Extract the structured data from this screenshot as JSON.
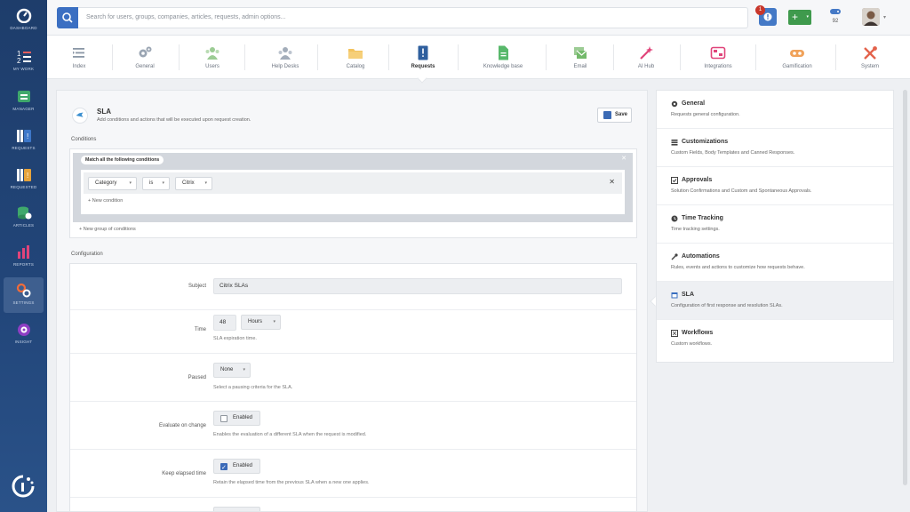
{
  "nav": {
    "items": [
      {
        "label": "DASHBOARD",
        "icon": "gauge-icon"
      },
      {
        "label": "MY WORK",
        "icon": "my-work-icon"
      },
      {
        "label": "MANAGER",
        "icon": "manager-icon"
      },
      {
        "label": "REQUESTS",
        "icon": "requests-icon"
      },
      {
        "label": "REQUESTED",
        "icon": "requested-icon"
      },
      {
        "label": "ARTICLES",
        "icon": "articles-icon"
      },
      {
        "label": "REPORTS",
        "icon": "reports-icon"
      },
      {
        "label": "SETTINGS",
        "icon": "settings-icon"
      },
      {
        "label": "INSIGHT",
        "icon": "insight-icon"
      }
    ]
  },
  "topbar": {
    "search_placeholder": "Search for users, groups, companies, articles, requests, admin options...",
    "notif_count": "1",
    "add_label": "+",
    "points": "92"
  },
  "tabs": [
    {
      "label": "Index"
    },
    {
      "label": "General"
    },
    {
      "label": "Users"
    },
    {
      "label": "Help Desks"
    },
    {
      "label": "Catalog"
    },
    {
      "label": "Requests"
    },
    {
      "label": "Knowledge base"
    },
    {
      "label": "Email"
    },
    {
      "label": "AI Hub"
    },
    {
      "label": "Integrations"
    },
    {
      "label": "Gamification"
    },
    {
      "label": "System"
    }
  ],
  "page": {
    "title": "SLA",
    "subtitle": "Add conditions and actions that will be executed upon request creation.",
    "save_label": "Save"
  },
  "conditions": {
    "title": "Conditions",
    "match_label": "Match all the following conditions",
    "field": "Category",
    "operator": "is",
    "value": "Citrix",
    "new_condition": "+ New condition",
    "new_group": "+ New group of conditions"
  },
  "configuration": {
    "title": "Configuration",
    "subject_label": "Subject",
    "subject_value": "Citrix SLAs",
    "time_label": "Time",
    "time_value": "48",
    "time_unit": "Hours",
    "time_help": "SLA expiration time.",
    "paused_label": "Paused",
    "paused_value": "None",
    "paused_help": "Select a pausing criteria for the SLA.",
    "evaluate_label": "Evaluate on change",
    "evaluate_value": "Enabled",
    "evaluate_checked": false,
    "evaluate_help": "Enables the evaluation of a different SLA when the request is modified.",
    "keep_label": "Keep elapsed time",
    "keep_value": "Enabled",
    "keep_checked": true,
    "keep_help": "Retain the elapsed time from the previous SLA when a new one applies."
  },
  "right_panel": {
    "items": [
      {
        "title": "General",
        "desc": "Requests general configuration.",
        "icon": "gear-icon"
      },
      {
        "title": "Customizations",
        "desc": "Custom Fields, Body Templates and Canned Responses.",
        "icon": "layers-icon"
      },
      {
        "title": "Approvals",
        "desc": "Solution Confirmations and Custom and Spontaneous Approvals.",
        "icon": "check-square-icon"
      },
      {
        "title": "Time Tracking",
        "desc": "Time tracking settings.",
        "icon": "clock-icon"
      },
      {
        "title": "Automations",
        "desc": "Rules, events and actions to customize how requests behave.",
        "icon": "wrench-icon"
      },
      {
        "title": "SLA",
        "desc": "Configuration of first response and resolution SLAs.",
        "icon": "calendar-icon"
      },
      {
        "title": "Workflows",
        "desc": "Custom workflows.",
        "icon": "workflow-icon"
      }
    ]
  }
}
